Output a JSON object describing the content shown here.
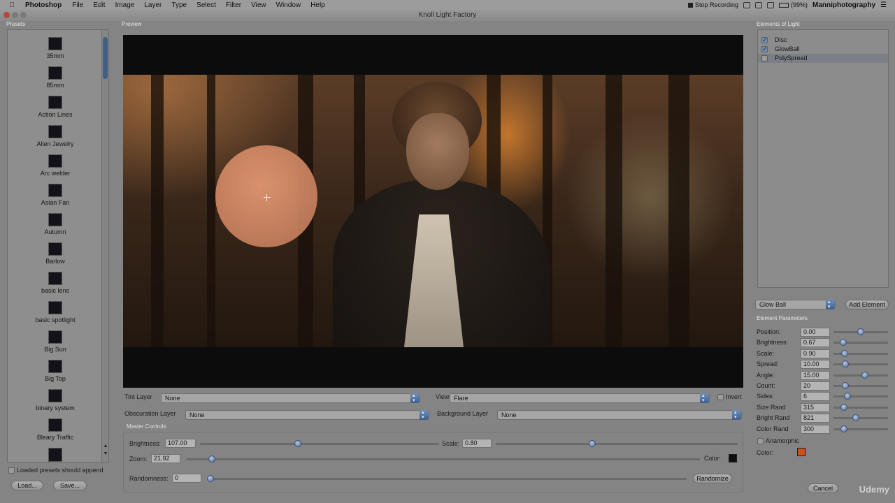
{
  "menubar": {
    "app_name": "Photoshop",
    "items": [
      "File",
      "Edit",
      "Image",
      "Layer",
      "Type",
      "Select",
      "Filter",
      "View",
      "Window",
      "Help"
    ],
    "recording": "Stop Recording",
    "battery": "(99%)",
    "user": "Manniphotography"
  },
  "window": {
    "title": "Knoll Light Factory"
  },
  "sections": {
    "presets": "Presets",
    "preview": "Preview",
    "elements": "Elements of Light",
    "master": "Master Controls",
    "params": "Element Parameters"
  },
  "presets": [
    {
      "label": "35mm"
    },
    {
      "label": "85mm"
    },
    {
      "label": "Action Lines"
    },
    {
      "label": "Alien Jewelry"
    },
    {
      "label": "Arc welder"
    },
    {
      "label": "Asian Fan"
    },
    {
      "label": "Autumn"
    },
    {
      "label": "Barlow"
    },
    {
      "label": "basic lens"
    },
    {
      "label": "basic spotlight"
    },
    {
      "label": "Big Sun"
    },
    {
      "label": "Big Top"
    },
    {
      "label": "binary system"
    },
    {
      "label": "Bleary Traffic"
    },
    {
      "label": ""
    }
  ],
  "preset_footer": {
    "append_label": "Loaded presets should append",
    "load_button": "Load...",
    "save_button": "Save..."
  },
  "layers": {
    "tint_label": "Tint Layer",
    "tint_value": "None",
    "view_label": "View",
    "view_value": "Flare",
    "invert_label": "Invert",
    "obscuration_label": "Obscuration Layer",
    "obscuration_value": "None",
    "background_label": "Background Layer",
    "background_value": "None"
  },
  "master": {
    "brightness_label": "Brightness:",
    "brightness_value": "107.00",
    "brightness_level": 0.41,
    "scale_label": "Scale:",
    "scale_value": "0.80",
    "scale_level": 0.4,
    "zoom_label": "Zoom:",
    "zoom_value": "21.92",
    "zoom_level": 0.05,
    "color_label": "Color:",
    "color": "#0d0d0d",
    "randomness_label": "Randomness:",
    "randomness_value": "0",
    "randomness_level": 0.0,
    "randomize_button": "Randomize"
  },
  "elements": [
    {
      "label": "Disc",
      "checked": true
    },
    {
      "label": "GlowBall",
      "checked": true
    },
    {
      "label": "PolySpread",
      "checked": false
    }
  ],
  "element_select": {
    "value": "Glow Ball",
    "add_button": "Add Element"
  },
  "params": [
    {
      "label": "Position:",
      "value": "0.00",
      "level": 0.5
    },
    {
      "label": "Brightness:",
      "value": "0.67",
      "level": 0.18
    },
    {
      "label": "Scale:",
      "value": "0.90",
      "level": 0.2
    },
    {
      "label": "Spread:",
      "value": "10.00",
      "level": 0.22
    },
    {
      "label": "Angle:",
      "value": "15.00",
      "level": 0.58
    },
    {
      "label": "Count:",
      "value": "20",
      "level": 0.22
    },
    {
      "label": "Sides:",
      "value": "6",
      "level": 0.26
    },
    {
      "label": "Size Rand",
      "value": "315",
      "level": 0.19
    },
    {
      "label": "Bright Rand",
      "value": "821",
      "level": 0.41
    },
    {
      "label": "Color Rand",
      "value": "300",
      "level": 0.19
    }
  ],
  "anamorphic_label": "Anamorphic",
  "param_color_label": "Color:",
  "param_color": "#c9541a",
  "cancel_button": "Cancel",
  "watermark": "Udemy"
}
